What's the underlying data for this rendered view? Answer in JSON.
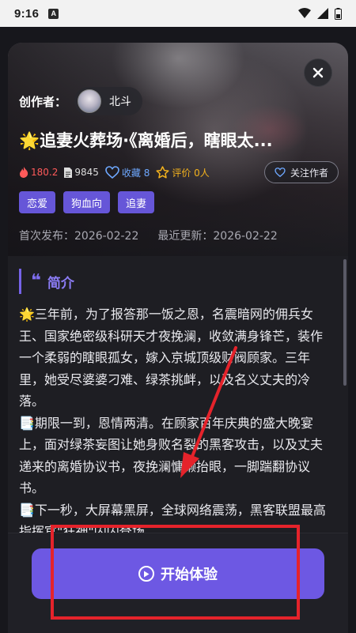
{
  "status_bar": {
    "time": "9:16",
    "app_icon_letter": "A"
  },
  "creator": {
    "label": "创作者：",
    "name": "北斗"
  },
  "title": "🌟追妻火葬场·《离婚后，瞎眼太...",
  "stats": {
    "heat": "180.2",
    "words": "9845",
    "favorites": "收藏 8",
    "rating": "评价 0人"
  },
  "follow_button": "关注作者",
  "tags": [
    "恋爱",
    "狗血向",
    "追妻"
  ],
  "dates": {
    "first_published": "首次发布：2026-02-22",
    "last_updated": "最近更新：2026-02-22"
  },
  "intro": {
    "heading": "简介",
    "paragraphs": [
      "🌟三年前，为了报答那一饭之恩，名震暗网的佣兵女王、国家绝密级科研天才夜挽澜，收敛满身锋芒，装作一个柔弱的瞎眼孤女，嫁入京城顶级财阀顾家。三年里，她受尽婆婆刁难、绿茶挑衅，以及名义丈夫的冷落。",
      "📑期限一到，恩情两清。在顾家百年庆典的盛大晚宴上，面对绿茶妄图让她身败名裂的黑客攻击，以及丈夫递来的离婚协议书，夜挽澜慵懒抬眼，一脚踹翻协议书。",
      "📑下一秒，大屏幕黑屏，全球网络震荡，黑客联盟最高指挥官\"狂神\"闪闪登场"
    ]
  },
  "start_button": "开始体验",
  "colors": {
    "accent": "#6d58e3",
    "tag": "#6656d8",
    "annotation": "#e5232b",
    "heat": "#ff5a5a",
    "favorite": "#6ea8ff",
    "rating": "#f3b21d"
  }
}
